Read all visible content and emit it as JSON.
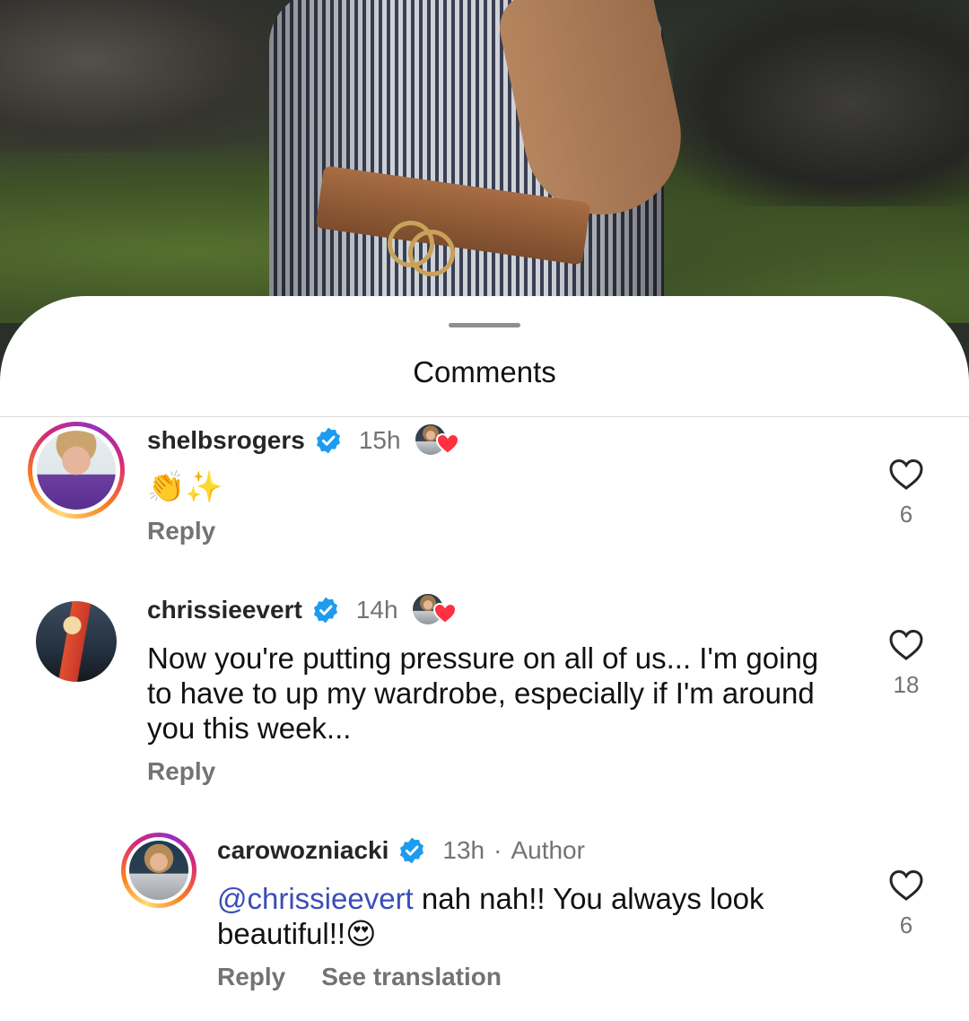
{
  "sheet": {
    "title": "Comments"
  },
  "comments": [
    {
      "username": "shelbsrogers",
      "time": "15h",
      "text": "👏✨",
      "reply_label": "Reply",
      "like_count": "6"
    },
    {
      "username": "chrissieevert",
      "time": "14h",
      "text": "Now you're putting pressure on all of us... I'm going to have to up my wardrobe, especially if I'm around you this week...",
      "reply_label": "Reply",
      "like_count": "18"
    }
  ],
  "reply": {
    "username": "carowozniacki",
    "time": "13h",
    "separator": "·",
    "author_label": "Author",
    "mention": "@chrissieevert",
    "text": " nah nah!! You always look beautiful!!😍",
    "reply_label": "Reply",
    "translate_label": "See translation",
    "like_count": "6"
  },
  "icons": {
    "verified": "verified-badge-icon",
    "heart": "heart-outline-icon",
    "liked_by_author": "author-liked-heart-icon"
  },
  "colors": {
    "verified": "#1d9bf0",
    "heart_red": "#ff3040",
    "mention": "#3a4db8",
    "muted": "#737373"
  }
}
